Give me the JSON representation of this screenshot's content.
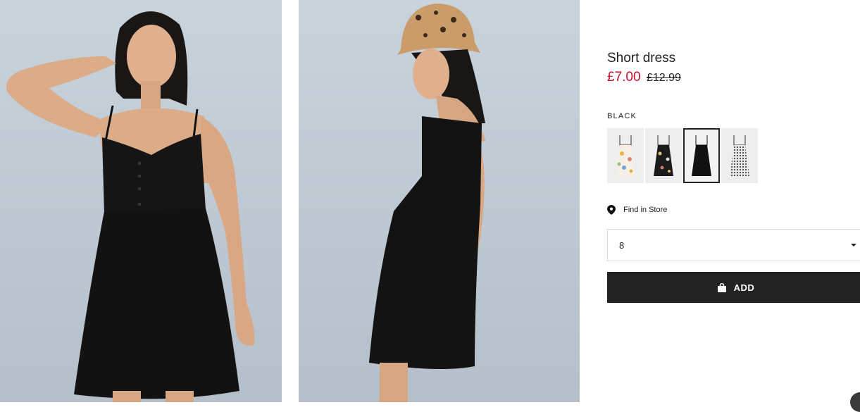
{
  "product": {
    "title": "Short dress",
    "price_sale": "£7.00",
    "price_original": "£12.99",
    "color_name": "BLACK"
  },
  "swatches": [
    {
      "name": "floral-white",
      "selected": false
    },
    {
      "name": "floral-black",
      "selected": false
    },
    {
      "name": "black",
      "selected": true
    },
    {
      "name": "gingham",
      "selected": false
    }
  ],
  "find_in_store": {
    "label": "Find in Store",
    "icon": "location-pin-icon"
  },
  "size_select": {
    "value": "8",
    "icon": "caret-down-icon"
  },
  "add_button": {
    "label": "ADD",
    "icon": "shopping-bag-icon"
  },
  "colors": {
    "sale": "#c8102e",
    "button": "#222222",
    "border": "#d8d8d8"
  }
}
